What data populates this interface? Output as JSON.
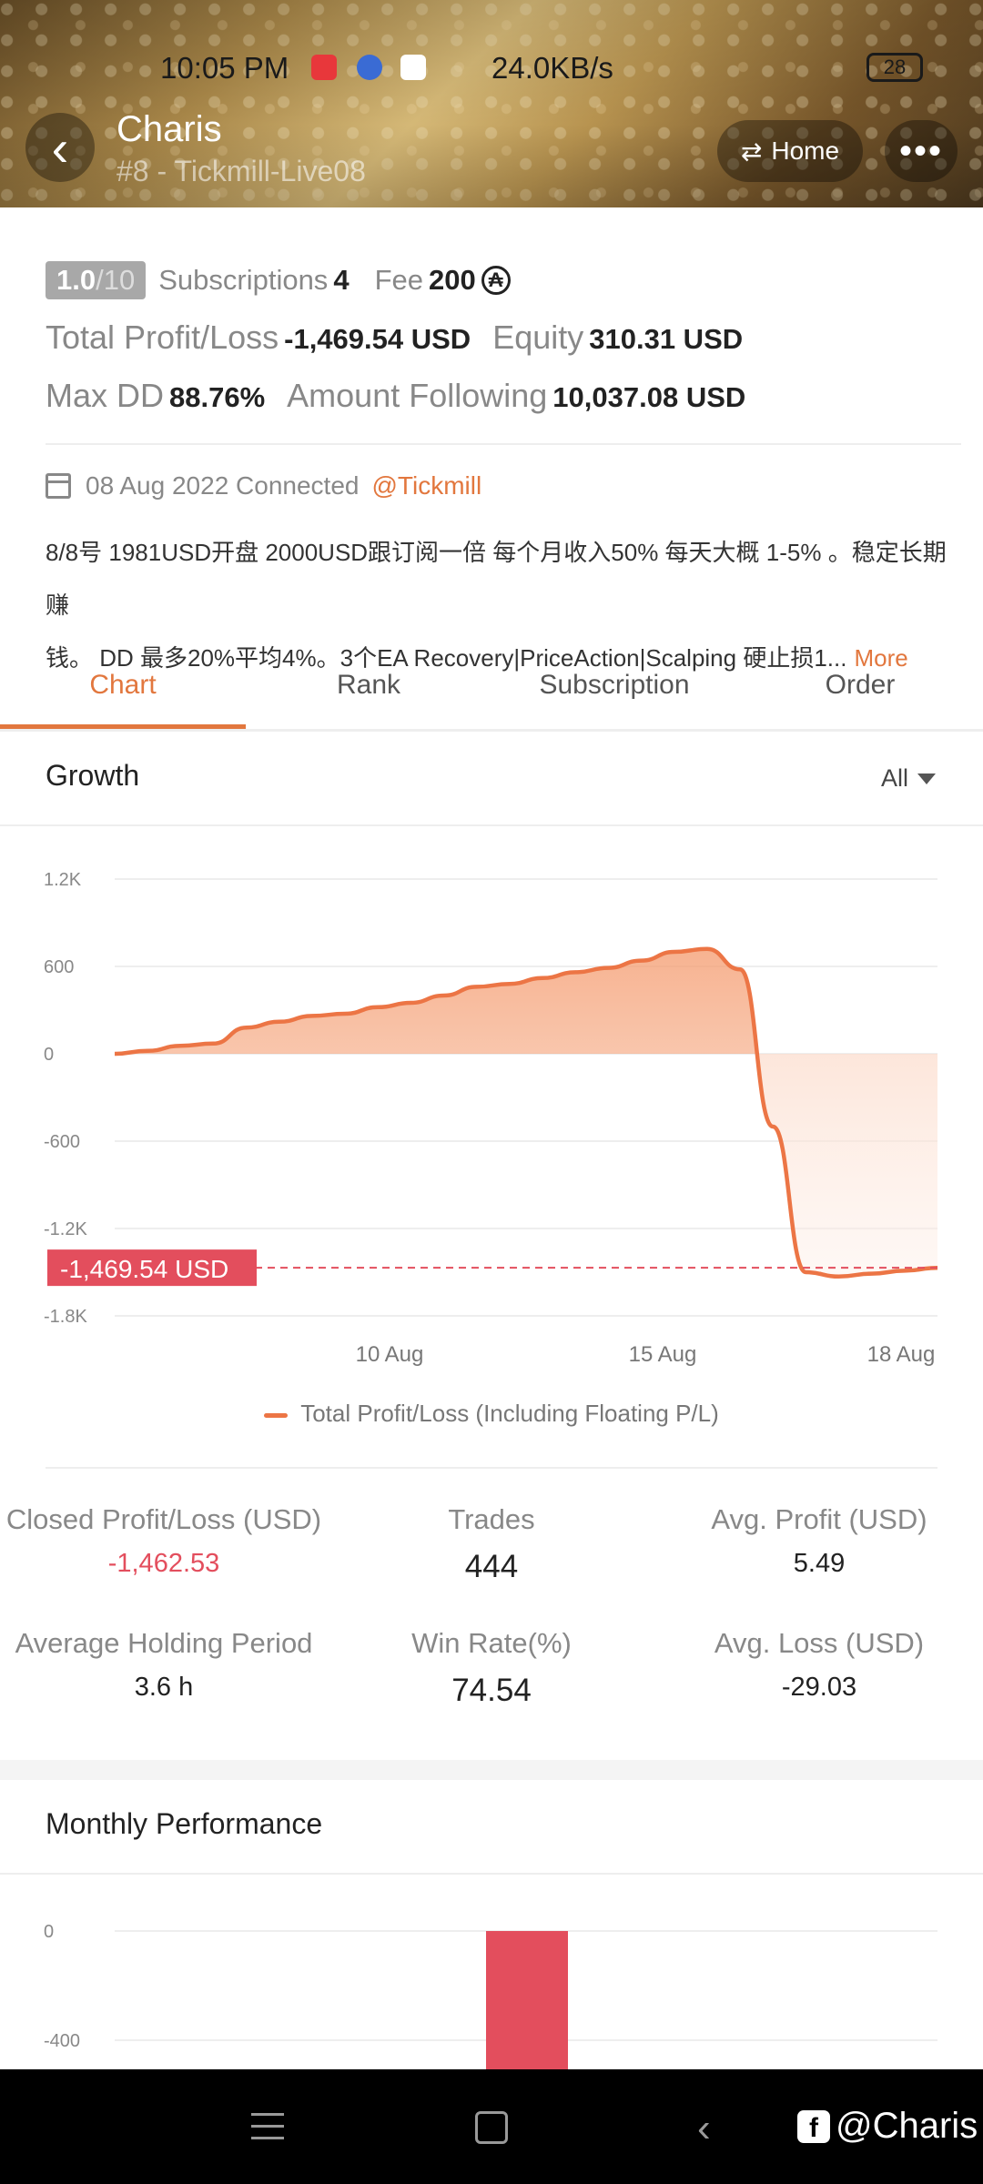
{
  "status_bar": {
    "time": "10:05 PM",
    "network": "24.0KB/s",
    "battery": "28"
  },
  "header": {
    "name": "Charis",
    "subtitle": "#8 - Tickmill-Live08",
    "home_label": "Home",
    "more_label": "•••"
  },
  "summary": {
    "rating": "1.0",
    "rating_max": "/10",
    "subscriptions_label": "Subscriptions",
    "subscriptions": "4",
    "fee_label": "Fee",
    "fee": "200",
    "total_pl_label": "Total Profit/Loss",
    "total_pl": "-1,469.54 USD",
    "equity_label": "Equity",
    "equity": "310.31 USD",
    "maxdd_label": "Max DD",
    "maxdd": "88.76%",
    "following_label": "Amount Following",
    "following": "10,037.08 USD"
  },
  "connection": {
    "date_text": "08 Aug 2022 Connected",
    "broker": "@Tickmill"
  },
  "description": {
    "line1": "8/8号 1981USD开盘 2000USD跟订阅一倍 每个月收入50% 每天大概 1-5% 。稳定长期赚",
    "line2": "钱。 DD 最多20%平均4%。3个EA Recovery|PriceAction|Scalping 硬止损1...",
    "more": "More"
  },
  "tabs": [
    "Chart",
    "Rank",
    "Subscription",
    "Order"
  ],
  "growth": {
    "title": "Growth",
    "filter": "All"
  },
  "chart_data": [
    {
      "type": "area",
      "title": "Growth",
      "yticks": [
        "1.2K",
        "600",
        "0",
        "-600",
        "-1.2K",
        "-1.8K"
      ],
      "ylim": [
        -1800,
        1200
      ],
      "xticks": [
        "10 Aug",
        "15 Aug",
        "18 Aug"
      ],
      "series": [
        {
          "name": "Total Profit/Loss (Including Floating P/L)",
          "color": "#ec7545",
          "values": [
            0,
            20,
            55,
            70,
            180,
            220,
            260,
            275,
            320,
            350,
            400,
            460,
            480,
            520,
            560,
            590,
            640,
            700,
            720,
            580,
            -500,
            -1500,
            -1530,
            -1510,
            -1490,
            -1470
          ]
        }
      ],
      "current_value_label": "-1,469.54 USD",
      "current_value": -1469.54,
      "grid": true
    },
    {
      "type": "bar",
      "title": "Monthly Performance",
      "yticks": [
        "0",
        "-400"
      ],
      "values": [
        -1469.54
      ],
      "color": "#e34e5d"
    }
  ],
  "legend": "Total Profit/Loss (Including Floating P/L)",
  "stats": {
    "closed_label": "Closed Profit/Loss (USD)",
    "closed": "-1,462.53",
    "trades_label": "Trades",
    "trades": "444",
    "avg_profit_label": "Avg. Profit (USD)",
    "avg_profit": "5.49",
    "holding_label": "Average Holding Period",
    "holding": "3.6 h",
    "winrate_label": "Win Rate(%)",
    "winrate": "74.54",
    "avg_loss_label": "Avg. Loss (USD)",
    "avg_loss": "-29.03"
  },
  "monthly": {
    "title": "Monthly Performance"
  },
  "watermark": "@Charis"
}
